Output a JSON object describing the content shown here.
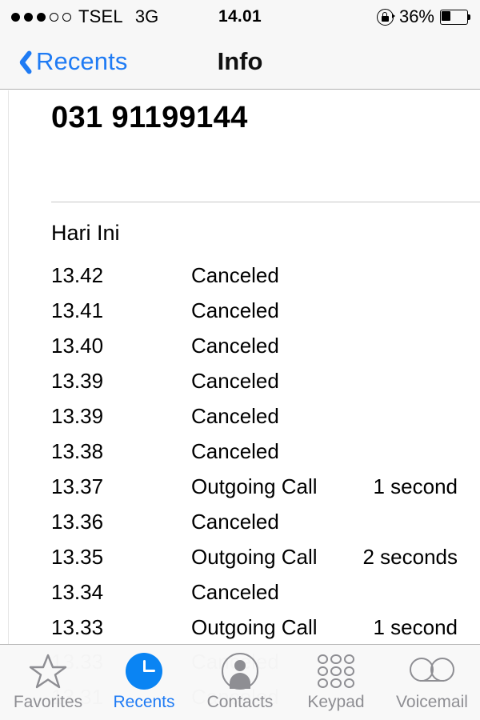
{
  "status_bar": {
    "signal_dots_filled": 3,
    "signal_dots_total": 5,
    "carrier": "TSEL",
    "network": "3G",
    "time": "14.01",
    "battery_percent": "36%",
    "battery_level": 36,
    "rotation_lock_icon": "rotation-lock-icon"
  },
  "nav_bar": {
    "back_label": "Recents",
    "back_icon": "chevron-left-icon",
    "title": "Info"
  },
  "contact": {
    "phone_number": "031 91199144"
  },
  "call_list": {
    "section_header": "Hari Ini",
    "rows": [
      {
        "time": "13.42",
        "type": "Canceled",
        "duration": ""
      },
      {
        "time": "13.41",
        "type": "Canceled",
        "duration": ""
      },
      {
        "time": "13.40",
        "type": "Canceled",
        "duration": ""
      },
      {
        "time": "13.39",
        "type": "Canceled",
        "duration": ""
      },
      {
        "time": "13.39",
        "type": "Canceled",
        "duration": ""
      },
      {
        "time": "13.38",
        "type": "Canceled",
        "duration": ""
      },
      {
        "time": "13.37",
        "type": "Outgoing Call",
        "duration": "1 second"
      },
      {
        "time": "13.36",
        "type": "Canceled",
        "duration": ""
      },
      {
        "time": "13.35",
        "type": "Outgoing Call",
        "duration": "2 seconds"
      },
      {
        "time": "13.34",
        "type": "Canceled",
        "duration": ""
      },
      {
        "time": "13.33",
        "type": "Outgoing Call",
        "duration": "1 second"
      }
    ],
    "obscured_rows": [
      {
        "time": "13.33",
        "type": "Canceled",
        "duration": ""
      },
      {
        "time": "13.31",
        "type": "Canceled",
        "duration": ""
      }
    ]
  },
  "tab_bar": {
    "active": "Recents",
    "tabs": [
      {
        "label": "Favorites",
        "icon": "star-icon"
      },
      {
        "label": "Recents",
        "icon": "clock-icon"
      },
      {
        "label": "Contacts",
        "icon": "person-circle-icon"
      },
      {
        "label": "Keypad",
        "icon": "keypad-grid-icon"
      },
      {
        "label": "Voicemail",
        "icon": "voicemail-icon"
      }
    ]
  },
  "colors": {
    "accent_blue": "#1f7bf4",
    "tab_active_blue": "#0a84f3",
    "inactive_gray": "#8e8e93",
    "bar_background": "#f7f7f7"
  }
}
